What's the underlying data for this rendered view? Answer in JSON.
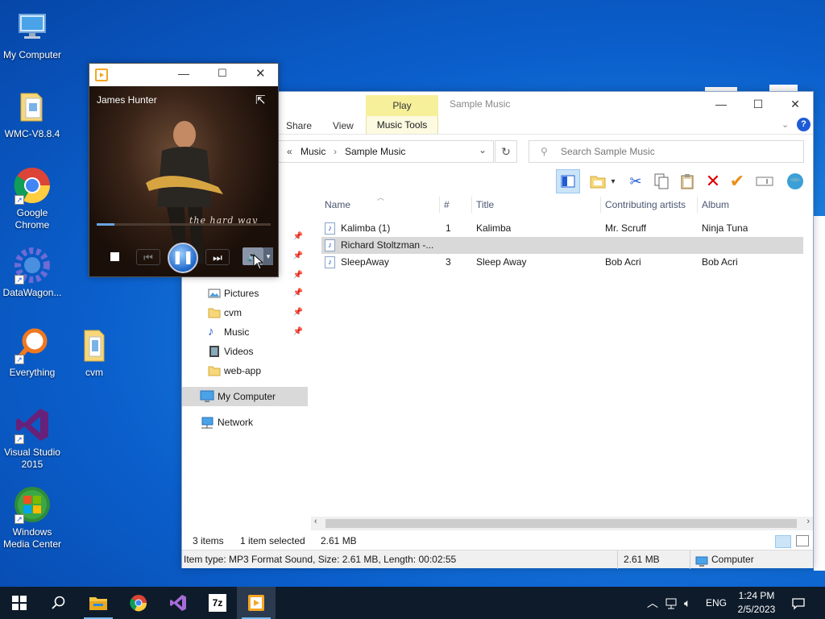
{
  "desktop": {
    "icons": [
      {
        "label": "My Computer"
      },
      {
        "label": "WMC-V8.8.4"
      },
      {
        "label": "Google Chrome"
      },
      {
        "label": "DataWagon..."
      },
      {
        "label": "Everything"
      },
      {
        "label": "cvm"
      },
      {
        "label": "Visual Studio 2015"
      },
      {
        "label": "Windows Media Center"
      }
    ]
  },
  "explorer": {
    "title": "Sample Music",
    "ribbon": {
      "contextual_tab": "Play",
      "tabs": [
        "Share",
        "View",
        "Music Tools"
      ]
    },
    "address": {
      "prefix": "«",
      "crumbs": [
        "Music",
        "Sample Music"
      ]
    },
    "search": {
      "placeholder": "Search Sample Music"
    },
    "nav": {
      "items": [
        {
          "label": "Pictures",
          "pinned": true
        },
        {
          "label": "cvm",
          "pinned": true
        },
        {
          "label": "Music",
          "pinned": true
        },
        {
          "label": "Videos",
          "pinned": false
        },
        {
          "label": "web-app",
          "pinned": false
        }
      ],
      "my_computer": "My Computer",
      "network": "Network"
    },
    "columns": [
      "Name",
      "#",
      "Title",
      "Contributing artists",
      "Album"
    ],
    "rows": [
      {
        "name": "Kalimba (1)",
        "num": "1",
        "title": "Kalimba",
        "artist": "Mr. Scruff",
        "album": "Ninja Tuna",
        "selected": false
      },
      {
        "name": "Richard Stoltzman -...",
        "num": "",
        "title": "",
        "artist": "",
        "album": "",
        "selected": true
      },
      {
        "name": "SleepAway",
        "num": "3",
        "title": "Sleep Away",
        "artist": "Bob Acri",
        "album": "Bob Acri",
        "selected": false
      }
    ],
    "status": {
      "items": "3 items",
      "selected": "1 item selected",
      "size": "2.61 MB"
    },
    "details": {
      "info": "Item type: MP3 Format Sound, Size: 2.61 MB, Length: 00:02:55",
      "size": "2.61 MB",
      "location": "Computer"
    }
  },
  "player": {
    "artist": "James Hunter",
    "album_text": "the hard way",
    "progress_fraction": 0.1
  },
  "taskbar": {
    "lang": "ENG",
    "time": "1:24 PM",
    "date": "2/5/2023"
  },
  "colors": {
    "accent": "#0078d7",
    "selection": "#d9d9d9",
    "play_tab": "#f7f09a"
  }
}
